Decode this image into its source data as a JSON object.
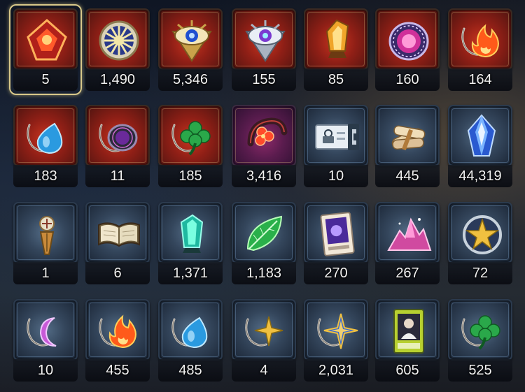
{
  "inventory": {
    "rows": [
      [
        {
          "icon": "red-crystal-icon",
          "count": "5",
          "frame": "red",
          "selected": true
        },
        {
          "icon": "sun-disc-icon",
          "count": "1,490",
          "frame": "red"
        },
        {
          "icon": "golden-eye-emblem-icon",
          "count": "5,346",
          "frame": "red"
        },
        {
          "icon": "silver-eye-emblem-icon",
          "count": "155",
          "frame": "red"
        },
        {
          "icon": "amber-crystal-icon",
          "count": "85",
          "frame": "red"
        },
        {
          "icon": "purple-disc-icon",
          "count": "160",
          "frame": "red"
        },
        {
          "icon": "fire-charm-icon",
          "count": "164",
          "frame": "red"
        }
      ],
      [
        {
          "icon": "blue-drop-charm-icon",
          "count": "183",
          "frame": "red"
        },
        {
          "icon": "dark-ring-charm-icon",
          "count": "11",
          "frame": "red"
        },
        {
          "icon": "clover-charm-icon",
          "count": "185",
          "frame": "red"
        },
        {
          "icon": "red-flower-charm-icon",
          "count": "3,416",
          "frame": "purple"
        },
        {
          "icon": "contract-ticket-icon",
          "count": "10",
          "frame": "blue"
        },
        {
          "icon": "scroll-bundle-icon",
          "count": "445",
          "frame": "blue"
        },
        {
          "icon": "blue-gem-icon",
          "count": "44,319",
          "frame": "blue"
        }
      ],
      [
        {
          "icon": "compass-pendant-icon",
          "count": "1",
          "frame": "blue"
        },
        {
          "icon": "open-book-icon",
          "count": "6",
          "frame": "blue"
        },
        {
          "icon": "teal-crystal-icon",
          "count": "1,371",
          "frame": "blue"
        },
        {
          "icon": "green-leaf-icon",
          "count": "1,183",
          "frame": "blue"
        },
        {
          "icon": "purple-card-icon",
          "count": "270",
          "frame": "blue"
        },
        {
          "icon": "pink-crystal-pile-icon",
          "count": "267",
          "frame": "blue"
        },
        {
          "icon": "star-medallion-icon",
          "count": "72",
          "frame": "blue"
        }
      ],
      [
        {
          "icon": "moon-charm-icon",
          "count": "10",
          "frame": "blue"
        },
        {
          "icon": "fire-charm-icon",
          "count": "455",
          "frame": "blue"
        },
        {
          "icon": "blue-drop-charm-icon",
          "count": "485",
          "frame": "blue"
        },
        {
          "icon": "star-charm-icon",
          "count": "4",
          "frame": "blue"
        },
        {
          "icon": "blue-star-charm-icon",
          "count": "2,031",
          "frame": "blue"
        },
        {
          "icon": "character-card-icon",
          "count": "605",
          "frame": "blue"
        },
        {
          "icon": "clover-charm-icon",
          "count": "525",
          "frame": "blue"
        }
      ]
    ]
  }
}
